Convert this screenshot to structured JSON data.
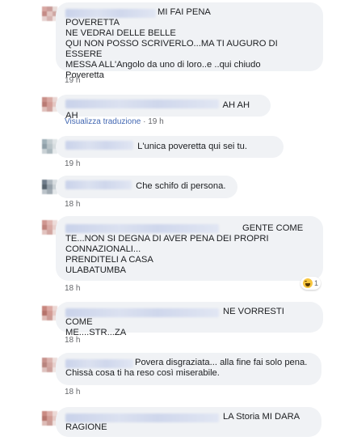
{
  "comments": [
    {
      "text": "MI FAI PENA\nPOVERETTA\nNE VEDRAI DELLE BELLE\nQUI NON POSSO SCRIVERLO...MA TI AUGURO DI ESSERE\nMESSA ALL'Angolo da uno di loro..e ..qui chiudo\nPoveretta",
      "time": "19 h"
    },
    {
      "text": "AH AH AH",
      "translate": "Visualizza traduzione",
      "separator": "·",
      "time": "19 h"
    },
    {
      "text": "L'unica poveretta qui sei tu.",
      "time": "19 h"
    },
    {
      "text": "Che schifo di persona.",
      "time": "18 h"
    },
    {
      "text": "GENTE COME\nTE...NON SI DEGNA DI AVER PENA DEI PROPRI\nCONNAZIONALI...\nPRENDITELI A CASA\nULABATUMBA",
      "time": "18 h",
      "reaction_count": "1",
      "reaction_icon": "haha-icon"
    },
    {
      "text": "NE VORRESTI COME\nME....STR...ZA",
      "time": "18 h"
    },
    {
      "text": "Povera disgraziata... alla fine fai solo pena.\nChissà cosa ti ha reso così miserabile.",
      "time": "18 h"
    },
    {
      "text": "LA Storia MI DARA\nRAGIONE",
      "time": "18 h"
    }
  ],
  "colors": {
    "bubble": "#f0f2f5",
    "meta": "#65676b",
    "link": "#4267b2"
  }
}
